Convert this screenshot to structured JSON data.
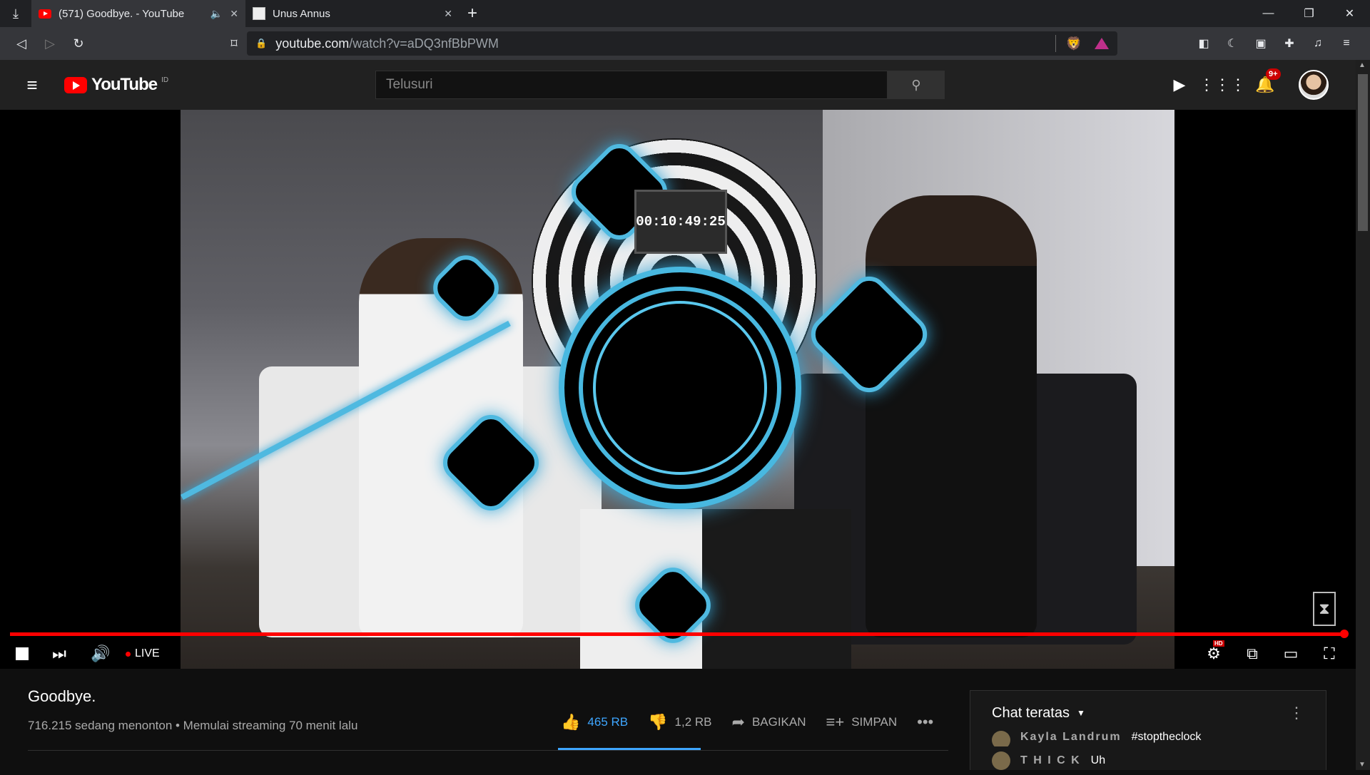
{
  "browser": {
    "tabs": [
      {
        "title": "(571) Goodbye. - YouTube"
      },
      {
        "title": "Unus Annus"
      }
    ],
    "url_host": "youtube.com",
    "url_path": "/watch?v=aDQ3nfBbPWM"
  },
  "youtube": {
    "logo_text": "YouTube",
    "country": "ID",
    "search_placeholder": "Telusuri",
    "notification_badge": "9+"
  },
  "player": {
    "timer": "00:10:49:25",
    "live_label": "LIVE",
    "progress": 1.0
  },
  "video": {
    "title": "Goodbye.",
    "meta": "716.215 sedang menonton • Memulai streaming 70 menit lalu",
    "like_count": "465 RB",
    "dislike_count": "1,2 RB",
    "share_label": "BAGIKAN",
    "save_label": "SIMPAN"
  },
  "chat": {
    "header": "Chat teratas",
    "messages": [
      {
        "author": "Kayla Landrum",
        "text": "#stoptheclock"
      },
      {
        "author": "T H I C K",
        "text": "Uh"
      }
    ]
  }
}
